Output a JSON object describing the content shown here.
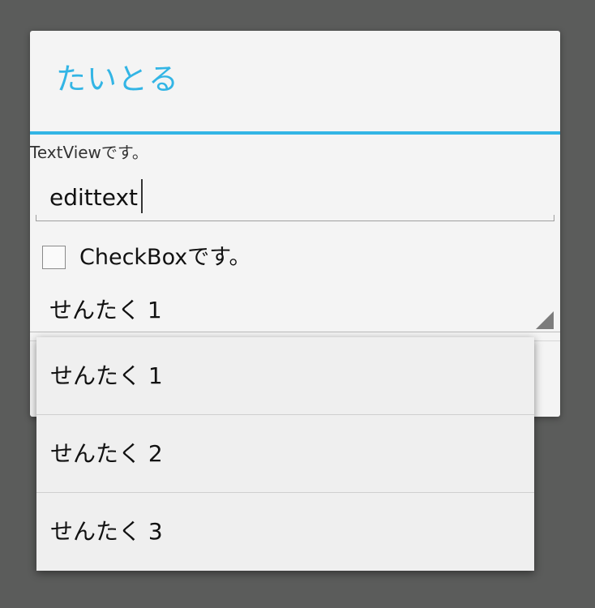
{
  "dialog": {
    "title": "たいとる",
    "textview": "TextViewです。",
    "edittext_value": "edittext",
    "checkbox": {
      "label": "CheckBoxです。",
      "checked": false
    },
    "spinner": {
      "selected": "せんたく 1"
    }
  },
  "dropdown": {
    "items": [
      {
        "label": "せんたく 1"
      },
      {
        "label": "せんたく 2"
      },
      {
        "label": "せんたく 3"
      }
    ]
  },
  "colors": {
    "accent": "#33b5e5",
    "background": "#5b5c5b",
    "dialog_background": "#f4f4f4"
  }
}
